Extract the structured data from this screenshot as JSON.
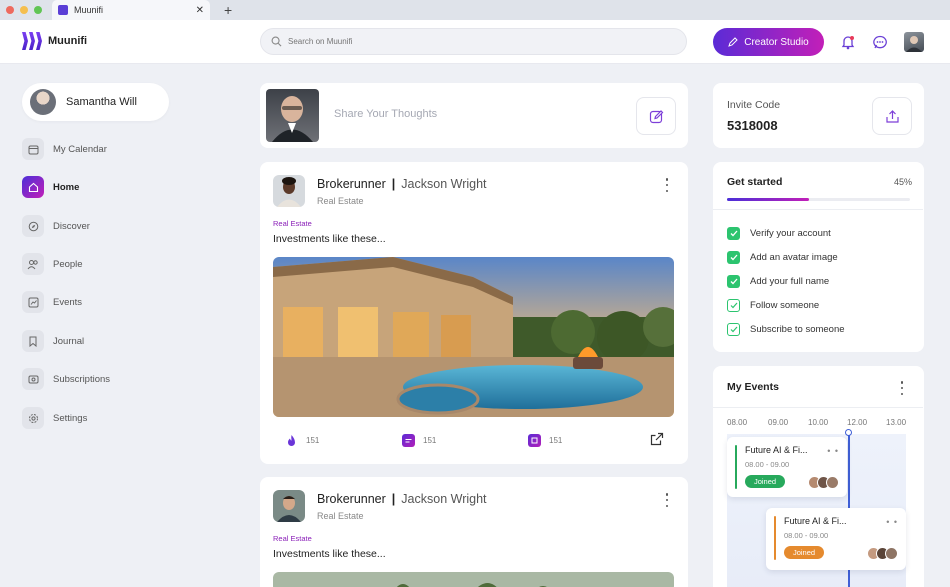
{
  "browser": {
    "tab_title": "Muunifi"
  },
  "header": {
    "brand": "Muunifi",
    "search_placeholder": "Search on Muunifi",
    "creator_button": "Creator Studio"
  },
  "sidebar": {
    "user_name": "Samantha Will",
    "items": [
      {
        "label": "My Calendar",
        "icon": "calendar-icon"
      },
      {
        "label": "Home",
        "icon": "home-icon",
        "active": true
      },
      {
        "label": "Discover",
        "icon": "compass-icon"
      },
      {
        "label": "People",
        "icon": "people-icon"
      },
      {
        "label": "Events",
        "icon": "chart-icon"
      },
      {
        "label": "Journal",
        "icon": "bookmark-icon"
      },
      {
        "label": "Subscriptions",
        "icon": "subscription-icon"
      },
      {
        "label": "Settings",
        "icon": "gear-icon"
      }
    ]
  },
  "composer": {
    "placeholder": "Share Your Thoughts"
  },
  "posts": [
    {
      "org": "Brokerunner",
      "separator": "|",
      "author": "Jackson Wright",
      "subtitle": "Real Estate",
      "tag": "Real Estate",
      "text": "Investments like these...",
      "stats": [
        "151",
        "151",
        "151"
      ]
    },
    {
      "org": "Brokerunner",
      "separator": "|",
      "author": "Jackson Wright",
      "subtitle": "Real Estate",
      "tag": "Real Estate",
      "text": "Investments like these..."
    }
  ],
  "invite": {
    "label": "Invite Code",
    "code": "5318008"
  },
  "get_started": {
    "title": "Get started",
    "percent_label": "45%",
    "progress": 0.45,
    "tasks": [
      {
        "label": "Verify your account",
        "done": true
      },
      {
        "label": "Add an avatar image",
        "done": true
      },
      {
        "label": "Add your full name",
        "done": true
      },
      {
        "label": "Follow someone",
        "done": false
      },
      {
        "label": "Subscribe to someone",
        "done": false
      }
    ]
  },
  "events": {
    "title": "My Events",
    "ticks": [
      "08.00",
      "09.00",
      "10.00",
      "12.00",
      "13.00"
    ],
    "items": [
      {
        "name": "Future AI & Fi...",
        "time": "08.00 - 09.00",
        "status": "Joined",
        "color": "#27a95c"
      },
      {
        "name": "Future AI & Fi...",
        "time": "08.00 - 09.00",
        "status": "Joined",
        "color": "#e58a2e"
      }
    ],
    "more": "• •"
  },
  "colors": {
    "accent": "#5b2bd6",
    "accent2": "#c21fb8",
    "success": "#2cc46f"
  }
}
